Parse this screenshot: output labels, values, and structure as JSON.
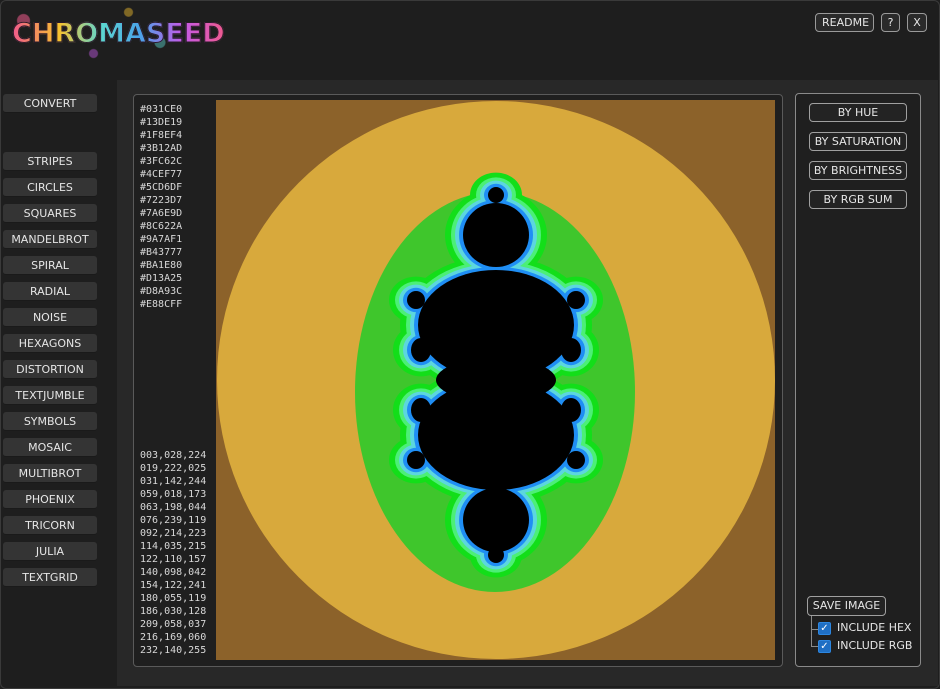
{
  "app": {
    "title": "CHROMASEED"
  },
  "top_buttons": {
    "readme": "README",
    "help": "?",
    "close": "X"
  },
  "nav": {
    "convert": "CONVERT",
    "items": [
      "STRIPES",
      "CIRCLES",
      "SQUARES",
      "MANDELBROT",
      "SPIRAL",
      "RADIAL",
      "NOISE",
      "HEXAGONS",
      "DISTORTION",
      "TEXTJUMBLE",
      "SYMBOLS",
      "MOSAIC",
      "MULTIBROT",
      "PHOENIX",
      "TRICORN",
      "JULIA",
      "TEXTGRID"
    ]
  },
  "palette": {
    "hex": [
      "#031CE0",
      "#13DE19",
      "#1F8EF4",
      "#3B12AD",
      "#3FC62C",
      "#4CEF77",
      "#5CD6DF",
      "#7223D7",
      "#7A6E9D",
      "#8C622A",
      "#9A7AF1",
      "#B43777",
      "#BA1E80",
      "#D13A25",
      "#D8A93C",
      "#E88CFF"
    ],
    "rgb": [
      "003,028,224",
      "019,222,025",
      "031,142,244",
      "059,018,173",
      "063,198,044",
      "076,239,119",
      "092,214,223",
      "114,035,215",
      "122,110,157",
      "140,098,042",
      "154,122,241",
      "180,055,119",
      "186,030,128",
      "209,058,037",
      "216,169,060",
      "232,140,255"
    ]
  },
  "fractal_colors": {
    "background": "#8c622a",
    "outer_band": "#d8a93c",
    "green_band": "#3fc62c",
    "bright_green": "#13de19",
    "mint": "#4cef77",
    "cyan": "#5cd6df",
    "blue": "#1f8ef4",
    "set": "#000000"
  },
  "sort": {
    "by_hue": "BY HUE",
    "by_saturation": "BY SATURATION",
    "by_brightness": "BY BRIGHTNESS",
    "by_rgb_sum": "BY RGB SUM"
  },
  "save": {
    "label": "SAVE IMAGE",
    "include_hex": "INCLUDE HEX",
    "include_rgb": "INCLUDE RGB",
    "include_hex_checked": true,
    "include_rgb_checked": true
  }
}
